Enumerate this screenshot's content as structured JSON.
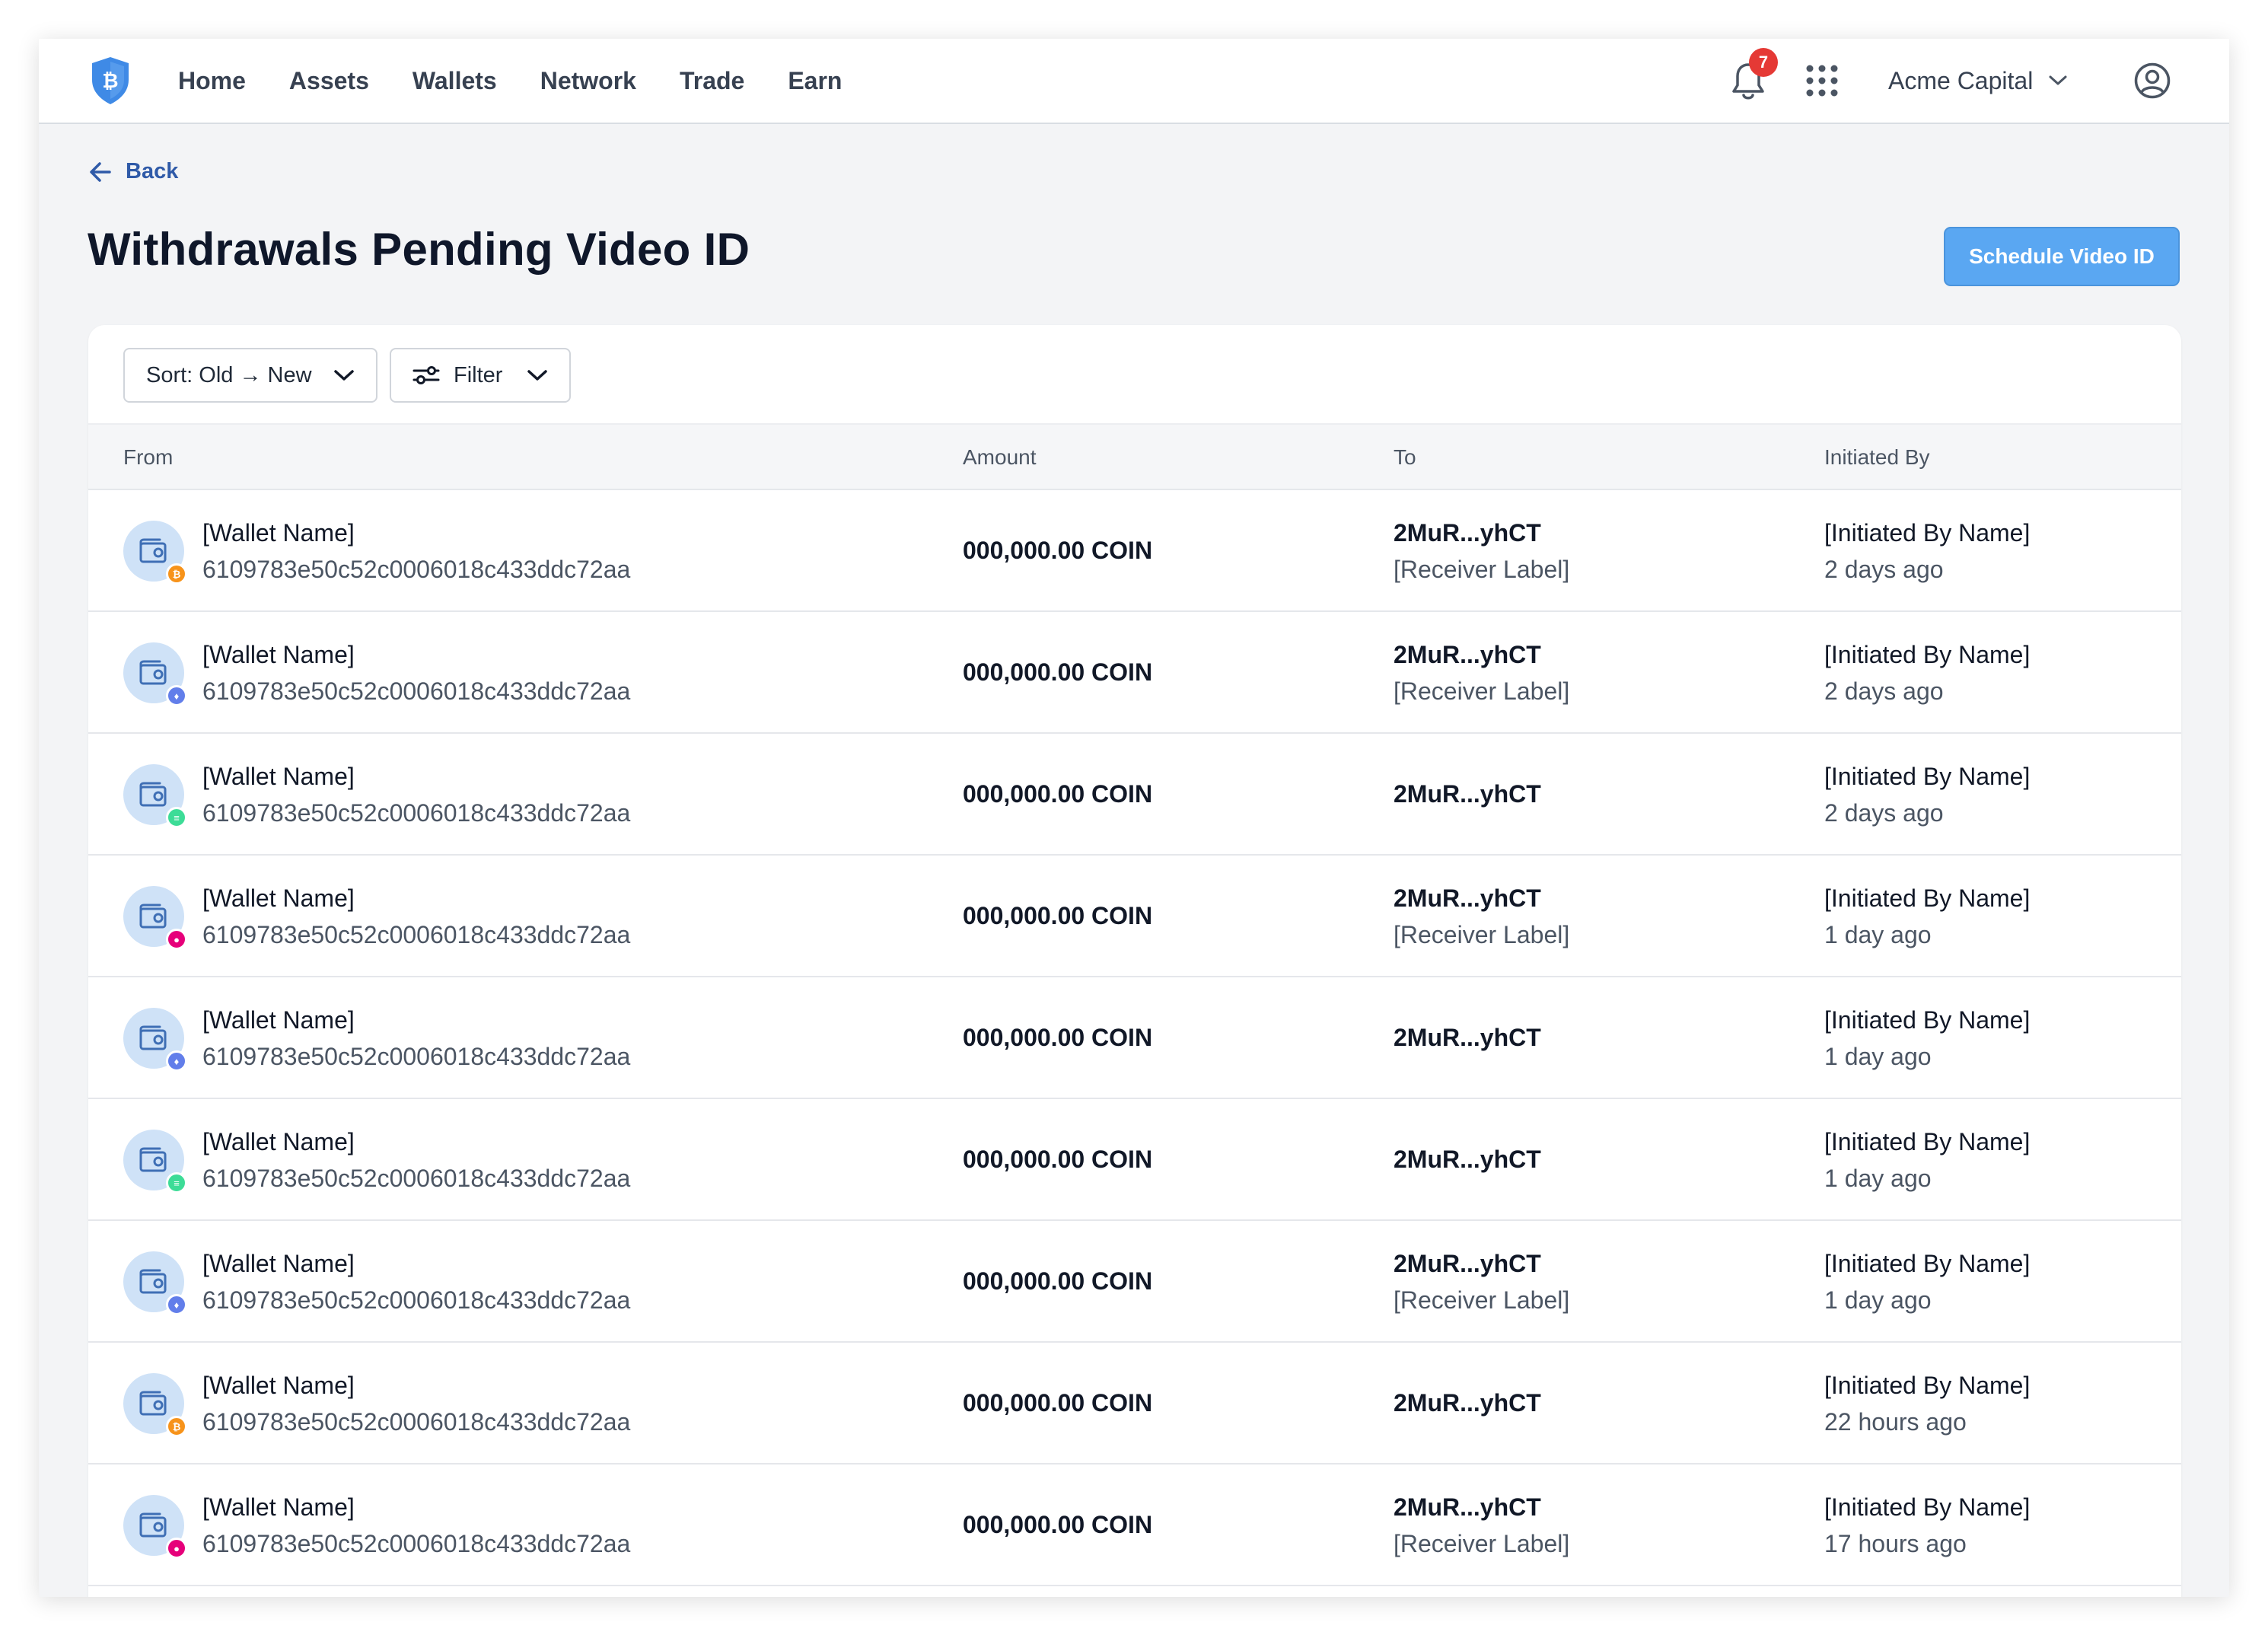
{
  "nav": {
    "links": [
      "Home",
      "Assets",
      "Wallets",
      "Network",
      "Trade",
      "Earn"
    ],
    "notification_count": "7",
    "org_name": "Acme Capital"
  },
  "page": {
    "back_label": "Back",
    "title": "Withdrawals Pending Video ID",
    "primary_button": "Schedule Video ID"
  },
  "toolbar": {
    "sort_label": "Sort: Old → New",
    "filter_label": "Filter"
  },
  "table": {
    "headers": [
      "From",
      "Amount",
      "To",
      "Initiated By"
    ],
    "rows": [
      {
        "wallet_name": "[Wallet Name]",
        "wallet_id": "6109783e50c52c0006018c433ddc72aa",
        "coin": "btc",
        "amount": "000,000.00 COIN",
        "to_address": "2MuR...yhCT",
        "to_label": "[Receiver Label]",
        "initiated_by": "[Initiated By Name]",
        "time": "2 days ago"
      },
      {
        "wallet_name": "[Wallet Name]",
        "wallet_id": "6109783e50c52c0006018c433ddc72aa",
        "coin": "eth",
        "amount": "000,000.00 COIN",
        "to_address": "2MuR...yhCT",
        "to_label": "[Receiver Label]",
        "initiated_by": "[Initiated By Name]",
        "time": "2 days ago"
      },
      {
        "wallet_name": "[Wallet Name]",
        "wallet_id": "6109783e50c52c0006018c433ddc72aa",
        "coin": "sol",
        "amount": "000,000.00 COIN",
        "to_address": "2MuR...yhCT",
        "to_label": "",
        "initiated_by": "[Initiated By Name]",
        "time": "2 days ago"
      },
      {
        "wallet_name": "[Wallet Name]",
        "wallet_id": "6109783e50c52c0006018c433ddc72aa",
        "coin": "dot",
        "amount": "000,000.00 COIN",
        "to_address": "2MuR...yhCT",
        "to_label": "[Receiver Label]",
        "initiated_by": "[Initiated By Name]",
        "time": "1 day ago"
      },
      {
        "wallet_name": "[Wallet Name]",
        "wallet_id": "6109783e50c52c0006018c433ddc72aa",
        "coin": "eth",
        "amount": "000,000.00 COIN",
        "to_address": "2MuR...yhCT",
        "to_label": "",
        "initiated_by": "[Initiated By Name]",
        "time": "1 day ago"
      },
      {
        "wallet_name": "[Wallet Name]",
        "wallet_id": "6109783e50c52c0006018c433ddc72aa",
        "coin": "sol",
        "amount": "000,000.00 COIN",
        "to_address": "2MuR...yhCT",
        "to_label": "",
        "initiated_by": "[Initiated By Name]",
        "time": "1 day ago"
      },
      {
        "wallet_name": "[Wallet Name]",
        "wallet_id": "6109783e50c52c0006018c433ddc72aa",
        "coin": "eth",
        "amount": "000,000.00 COIN",
        "to_address": "2MuR...yhCT",
        "to_label": "[Receiver Label]",
        "initiated_by": "[Initiated By Name]",
        "time": "1 day ago"
      },
      {
        "wallet_name": "[Wallet Name]",
        "wallet_id": "6109783e50c52c0006018c433ddc72aa",
        "coin": "btc",
        "amount": "000,000.00 COIN",
        "to_address": "2MuR...yhCT",
        "to_label": "",
        "initiated_by": "[Initiated By Name]",
        "time": "22 hours ago"
      },
      {
        "wallet_name": "[Wallet Name]",
        "wallet_id": "6109783e50c52c0006018c433ddc72aa",
        "coin": "dot",
        "amount": "000,000.00 COIN",
        "to_address": "2MuR...yhCT",
        "to_label": "[Receiver Label]",
        "initiated_by": "[Initiated By Name]",
        "time": "17 hours ago"
      }
    ]
  },
  "colors": {
    "primary_button": "#5aa7f2",
    "link": "#2f5aa8",
    "badge": "#e53935",
    "coin_btc": "#f7931a",
    "coin_eth": "#627eea",
    "coin_sol": "#3ddc97",
    "coin_dot": "#e6007a"
  },
  "icons": {
    "logo": "shield-bitcoin-icon",
    "notifications": "bell-icon",
    "apps": "grid-icon",
    "org_menu": "chevron-down-icon",
    "profile": "user-circle-icon",
    "back": "arrow-left-icon",
    "filter": "sliders-icon",
    "wallet": "wallet-icon"
  }
}
